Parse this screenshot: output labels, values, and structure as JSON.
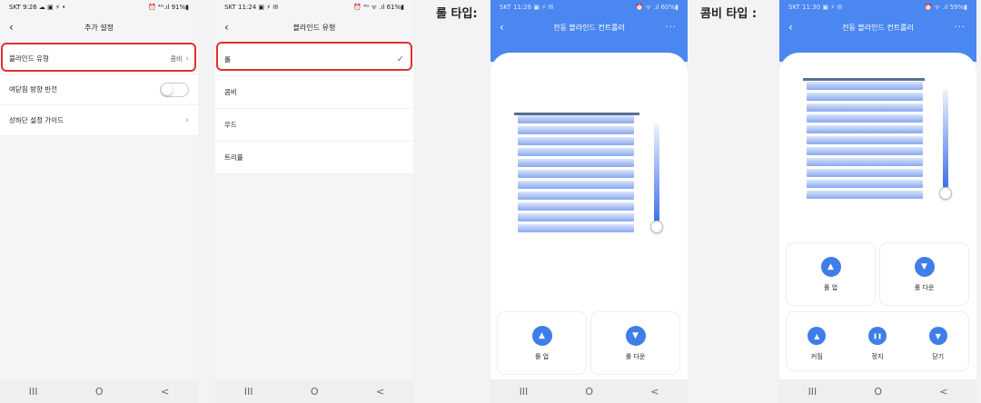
{
  "nav": {
    "recent": "III",
    "home": "O",
    "back": "<"
  },
  "labels": {
    "roll": "롤 타입:",
    "combi": "콤비 타입 :"
  },
  "screen1": {
    "status_left": "SKT 9:26 ☁ ▣ ⚡ •",
    "status_right": "⏰ ⁴ᴳ.ıl 91%▮",
    "title": "추가 설정",
    "rows": [
      {
        "label": "블라인드 유형",
        "value": "콤비"
      },
      {
        "label": "여닫힘 방향 반전",
        "value": ""
      },
      {
        "label": "상하단 설정 가이드",
        "value": ""
      }
    ]
  },
  "screen2": {
    "status_left": "SKT 11:24 ▣ ⚡ ✉",
    "status_right": "⏰ ⁴ᴳ ᯤ .ıl 61%▮",
    "title": "블라인드 유형",
    "options": [
      "롤",
      "콤비",
      "우드",
      "트리플"
    ],
    "selected": "롤"
  },
  "screen3": {
    "status_left": "SKT 11:26 ▣ ⚡ ✉",
    "status_right": "⏰ ᯤ .ıl 60%▮",
    "title": "전동 블라인드 컨트롤러",
    "more": "···",
    "buttons": [
      {
        "label": "롤 업",
        "icon": "eject-up-icon",
        "glyph": "▲"
      },
      {
        "label": "롤 다운",
        "icon": "eject-down-icon",
        "glyph": "▼"
      }
    ]
  },
  "screen4": {
    "status_left": "SKT 11:30 ▣ ⚡ ✉",
    "status_right": "⏰ ᯤ .ıl 59%▮",
    "title": "전동 블라인드 컨트롤러",
    "more": "···",
    "buttons": [
      {
        "label": "롤 업",
        "icon": "eject-up-icon",
        "glyph": "▲"
      },
      {
        "label": "롤 다운",
        "icon": "eject-down-icon",
        "glyph": "▼"
      }
    ],
    "group": [
      {
        "label": "커짐",
        "icon": "up-icon",
        "glyph": "▲"
      },
      {
        "label": "정지",
        "icon": "pause-icon",
        "glyph": "❚❚"
      },
      {
        "label": "닫기",
        "icon": "down-icon",
        "glyph": "▼"
      }
    ]
  },
  "colors": {
    "accent": "#4a87f0",
    "highlight": "#e03030",
    "check": "#3f7de8"
  }
}
